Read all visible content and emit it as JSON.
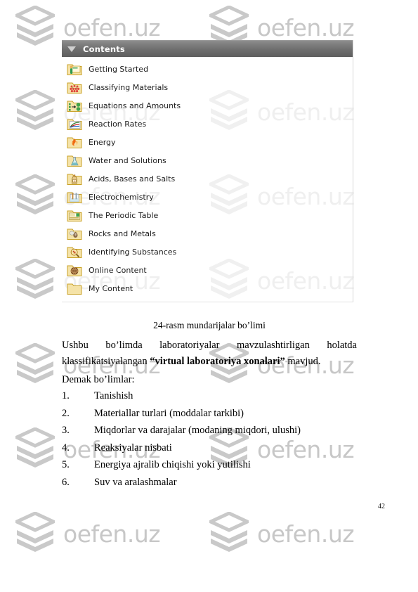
{
  "watermark": {
    "text": "oefen.uz",
    "logo_icon": "stacked-layers-logo",
    "color": "#c7c7c7"
  },
  "contents_panel": {
    "header": {
      "title": "Contents",
      "collapse_icon": "triangle-down-icon"
    },
    "items": [
      {
        "label": "Getting Started",
        "icon": "folder-getting-started-icon"
      },
      {
        "label": "Classifying Materials",
        "icon": "folder-classifying-materials-icon"
      },
      {
        "label": "Equations and Amounts",
        "icon": "folder-equations-amounts-icon"
      },
      {
        "label": "Reaction Rates",
        "icon": "folder-reaction-rates-icon"
      },
      {
        "label": "Energy",
        "icon": "folder-energy-flame-icon"
      },
      {
        "label": "Water and Solutions",
        "icon": "folder-water-flask-icon"
      },
      {
        "label": "Acids, Bases and Salts",
        "icon": "folder-acid-bottle-icon"
      },
      {
        "label": "Electrochemistry",
        "icon": "folder-electrochemistry-icon"
      },
      {
        "label": "The Periodic Table",
        "icon": "folder-periodic-table-icon"
      },
      {
        "label": "Rocks and Metals",
        "icon": "folder-rocks-metals-icon"
      },
      {
        "label": "Identifying Substances",
        "icon": "folder-magnifier-icon"
      },
      {
        "label": "Online Content",
        "icon": "folder-globe-icon"
      },
      {
        "label": "My Content",
        "icon": "folder-plain-icon"
      }
    ]
  },
  "document": {
    "figure_caption": "24-rasm mundarijalar bo’limi",
    "paragraph_lead": "Ushbu  bo’limda  laboratoriyalar  mavzulashtirligan  holatda  klassifikatsiyalangan ",
    "paragraph_bold": "“virtual laboratoriya xonalari”",
    "paragraph_tail": " mavjud.",
    "demak_line": "Demak bo’limlar:",
    "list": [
      {
        "num": "1.",
        "text": "Tanishish"
      },
      {
        "num": "2.",
        "text": "Materiallar turlari (moddalar tarkibi)"
      },
      {
        "num": "3.",
        "text": "Miqdorlar va darajalar (modaning miqdori, ulushi)"
      },
      {
        "num": "4.",
        "text": "Reaksiyalar nisbati"
      },
      {
        "num": "5.",
        "text": "Energiya ajralib chiqishi yoki yutilishi"
      },
      {
        "num": "6.",
        "text": "Suv va aralashmalar"
      }
    ],
    "page_number": "42"
  }
}
